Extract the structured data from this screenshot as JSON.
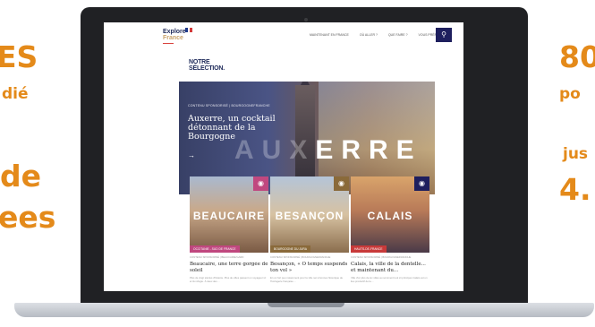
{
  "left_promo": {
    "line1": "ES",
    "line2": "dié",
    "line3": "de",
    "line4": "ees"
  },
  "right_promo": {
    "line1": "80",
    "line2": "po",
    "line3": "jus",
    "line4": "4."
  },
  "site": {
    "logo_line1": "Explore",
    "logo_line2": "France",
    "nav": [
      "MAINTENANT EN FRANCE",
      "OÙ ALLER ?",
      "QUE FAIRE ?",
      "VOUS PRÉPARER"
    ],
    "search_icon": "search-icon",
    "selection_title_line1": "NOTRE",
    "selection_title_line2": "SÉLECTION."
  },
  "hero": {
    "kicker": "CONTENU SPONSORISÉ | BOURGOGNEFRANCHE",
    "title": "Auxerre, un cocktail détonnant de la Bourgogne",
    "arrow": "→",
    "word_faint": "AUX",
    "word": "ERRE"
  },
  "cards": [
    {
      "word": "BEAUCAIRE",
      "tag": "OCCITANIE - SUD DE FRANCE",
      "kicker": "CONTENU SPONSORISÉ | BEAUCAIRE/GARD",
      "title": "Beaucaire, une terre gorgée de soleil",
      "excerpt": "Plus de vingt siècles d'histoire. Plus de villes passent un voyageur ici et ils réfugie. À deux des ..."
    },
    {
      "word": "BESANÇON",
      "tag": "BOURGOGNE DU JURA",
      "kicker": "CONTENU SPONSORISÉ | BOURGOGNEFRANCHE",
      "title": "Besançon, « Ô temps suspends ton vol »",
      "excerpt": "En un fort peu notamment pour la ville net à bonnes historique de l'horlogerie française ..."
    },
    {
      "word": "CALAIS",
      "tag": "HAUTS-DE-FRANCE",
      "kicker": "CONTENU SPONSORISÉ | BOURGOGNEFRANCHE",
      "title": "Calais, la ville de la dentelle... et maintenant du...",
      "excerpt": "Ville d'or plus de six villes au somment tout ici principes Calais est un lieu productif de la ..."
    }
  ],
  "colors": {
    "accent_orange": "#e48a1a",
    "navy": "#1e1f5e",
    "tag_pink": "#c0487f",
    "tag_brown": "#8a6a3a",
    "tag_red": "#c83a3a"
  }
}
